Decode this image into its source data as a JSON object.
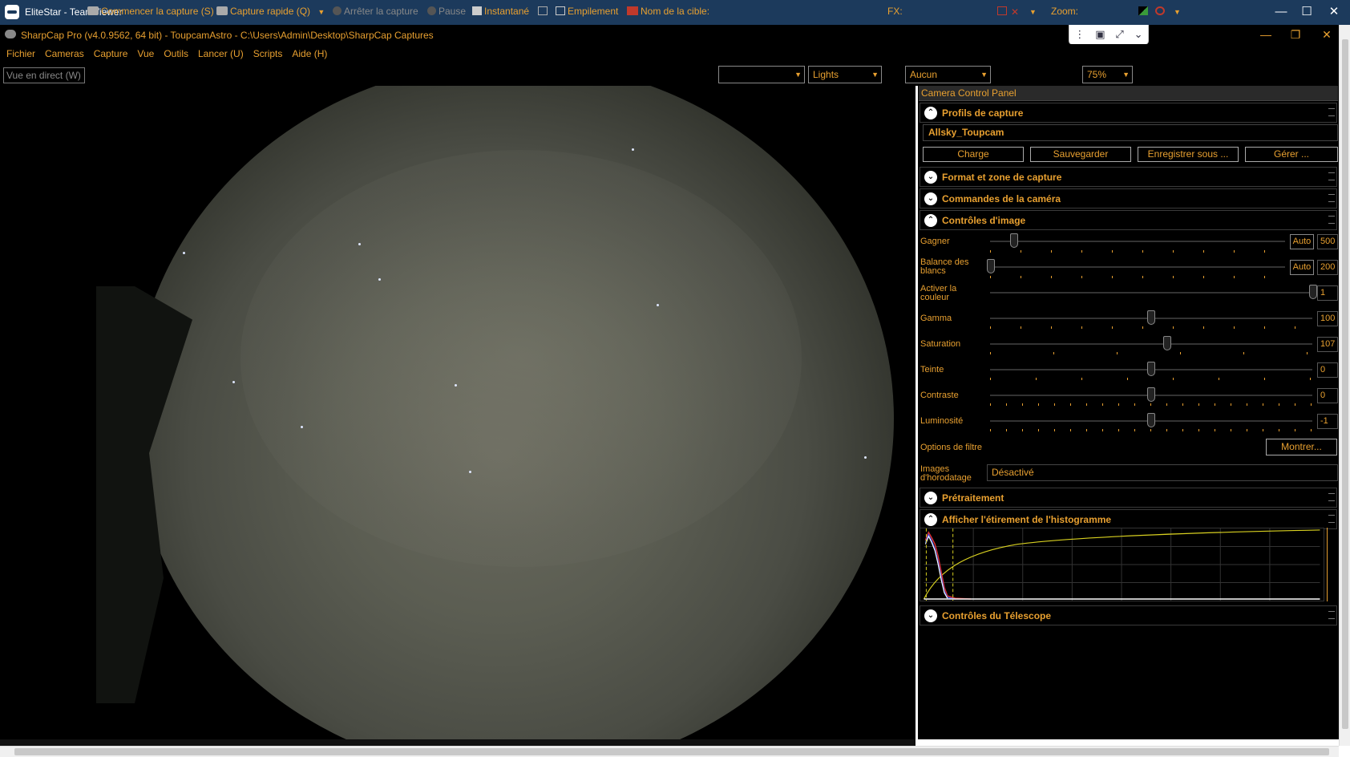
{
  "teamviewer": {
    "title": "EliteStar - TeamViewer"
  },
  "sharpcap": {
    "title": "SharpCap Pro (v4.0.9562, 64 bit) - ToupcamAstro - C:\\Users\\Admin\\Desktop\\SharpCap Captures"
  },
  "menu": [
    "Fichier",
    "Cameras",
    "Capture",
    "Vue",
    "Outils",
    "Lancer (U)",
    "Scripts",
    "Aide (H)"
  ],
  "toolbar": {
    "live_view": "Vue en direct (W)",
    "start_capture": "Commencer la capture (S)",
    "quick_capture": "Capture rapide (Q)",
    "stop_capture": "Arrêter la capture",
    "pause": "Pause",
    "snapshot": "Instantané",
    "stacking": "Empilement",
    "target_label": "Nom de la cible:",
    "target_value": "",
    "frame_type": "Lights",
    "fx_label": "FX:",
    "fx_value": "Aucun",
    "zoom_label": "Zoom:",
    "zoom_value": "75%"
  },
  "panel": {
    "title": "Camera Control Panel",
    "sections": {
      "profiles": "Profils de capture",
      "format": "Format et zone de capture",
      "camera": "Commandes de la caméra",
      "image": "Contrôles d'image",
      "preprocessing": "Prétraitement",
      "histogram": "Afficher l'étirement de l'histogramme",
      "telescope": "Contrôles du Télescope"
    },
    "profile_value": "Allsky_Toupcam",
    "profile_buttons": [
      "Charge",
      "Sauvegarder",
      "Enregistrer sous ...",
      "Gérer ..."
    ],
    "controls": [
      {
        "label": "Gagner",
        "auto": "Auto",
        "value": "500"
      },
      {
        "label": "Balance des blancs",
        "auto": "Auto",
        "value": "200"
      },
      {
        "label": "Activer la couleur",
        "value": "1"
      },
      {
        "label": "Gamma",
        "value": "100"
      },
      {
        "label": "Saturation",
        "value": "107"
      },
      {
        "label": "Teinte",
        "value": "0"
      },
      {
        "label": "Contraste",
        "value": "0"
      },
      {
        "label": "Luminosité",
        "value": "-1"
      }
    ],
    "filter_label": "Options de filtre",
    "filter_button": "Montrer...",
    "timestamp_label": "Images d'horodatage",
    "timestamp_value": "Désactivé"
  },
  "colors": {
    "accent": "#e8a030",
    "background": "#000000",
    "teamviewer": "#1c3a5c"
  }
}
